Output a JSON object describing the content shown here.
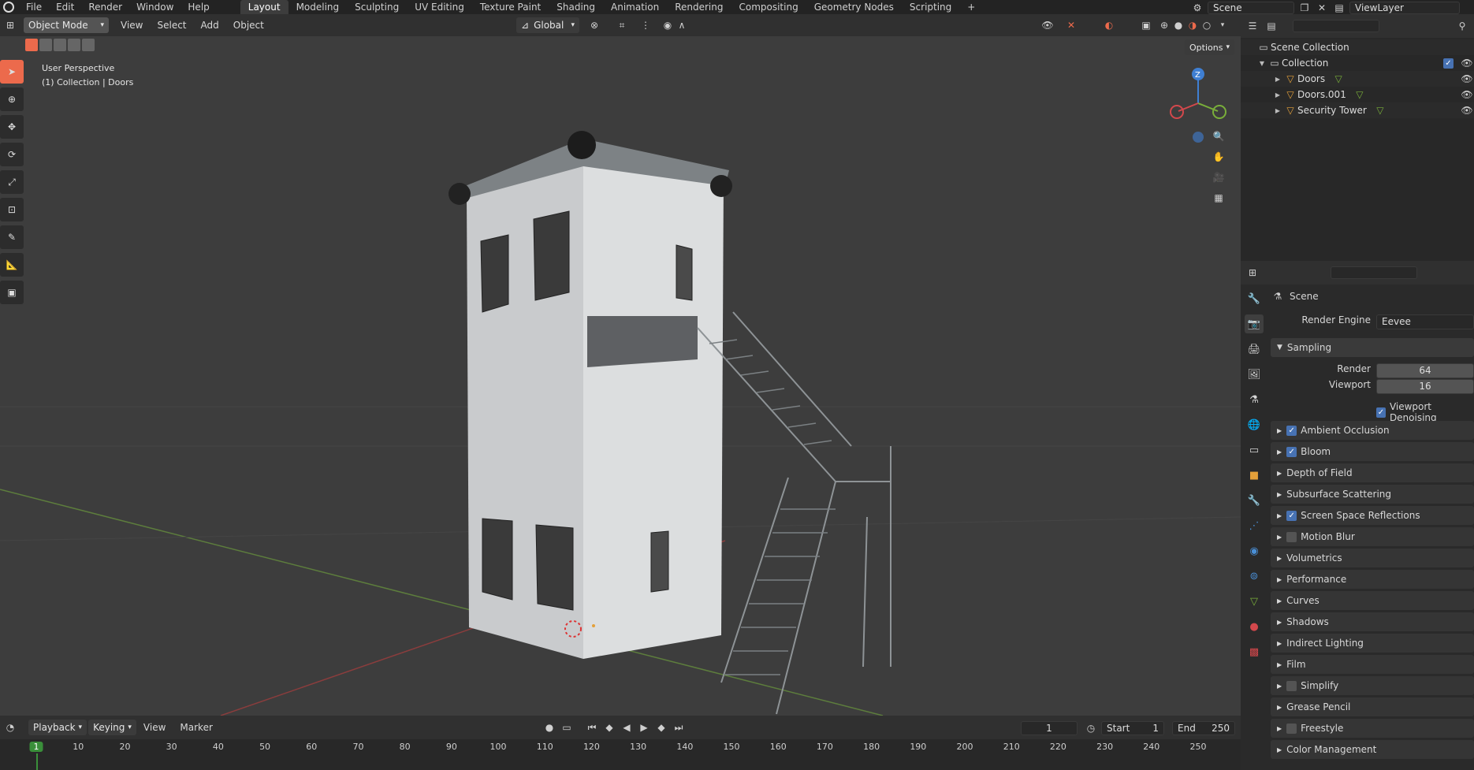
{
  "topbar": {
    "menus": [
      "File",
      "Edit",
      "Render",
      "Window",
      "Help"
    ],
    "workspaces": [
      "Layout",
      "Modeling",
      "Sculpting",
      "UV Editing",
      "Texture Paint",
      "Shading",
      "Animation",
      "Rendering",
      "Compositing",
      "Geometry Nodes",
      "Scripting"
    ],
    "active_workspace": "Layout",
    "add_tab": "+",
    "scene": "Scene",
    "view_layer": "ViewLayer"
  },
  "viewport_header": {
    "mode": "Object Mode",
    "menus": [
      "View",
      "Select",
      "Add",
      "Object"
    ],
    "orientation": "Global",
    "options": "Options"
  },
  "viewport": {
    "perspective": "User Perspective",
    "context": "(1) Collection | Doors",
    "axis_labels": {
      "z": "Z"
    }
  },
  "outliner": {
    "root": "Scene Collection",
    "collection": "Collection",
    "items": [
      "Doors",
      "Doors.001",
      "Security Tower"
    ]
  },
  "properties": {
    "scene_label": "Scene",
    "render_engine_label": "Render Engine",
    "render_engine_value": "Eevee",
    "sampling_label": "Sampling",
    "render_label": "Render",
    "render_value": "64",
    "viewport_label": "Viewport",
    "viewport_value": "16",
    "viewport_denoising": "Viewport Denoising",
    "sections": [
      {
        "label": "Ambient Occlusion",
        "checkbox": true,
        "checked": true
      },
      {
        "label": "Bloom",
        "checkbox": true,
        "checked": true
      },
      {
        "label": "Depth of Field",
        "checkbox": false
      },
      {
        "label": "Subsurface Scattering",
        "checkbox": false
      },
      {
        "label": "Screen Space Reflections",
        "checkbox": true,
        "checked": true
      },
      {
        "label": "Motion Blur",
        "checkbox": true,
        "checked": false
      },
      {
        "label": "Volumetrics",
        "checkbox": false
      },
      {
        "label": "Performance",
        "checkbox": false
      },
      {
        "label": "Curves",
        "checkbox": false
      },
      {
        "label": "Shadows",
        "checkbox": false
      },
      {
        "label": "Indirect Lighting",
        "checkbox": false
      },
      {
        "label": "Film",
        "checkbox": false
      },
      {
        "label": "Simplify",
        "checkbox": true,
        "checked": false
      },
      {
        "label": "Grease Pencil",
        "checkbox": false
      },
      {
        "label": "Freestyle",
        "checkbox": true,
        "checked": false
      },
      {
        "label": "Color Management",
        "checkbox": false
      }
    ]
  },
  "timeline": {
    "menus": [
      "Playback",
      "Keying",
      "View",
      "Marker"
    ],
    "current_frame": "1",
    "start_label": "Start",
    "start_value": "1",
    "end_label": "End",
    "end_value": "250",
    "ruler": [
      "1",
      "10",
      "20",
      "30",
      "40",
      "50",
      "60",
      "70",
      "80",
      "90",
      "100",
      "110",
      "120",
      "130",
      "140",
      "150",
      "160",
      "170",
      "180",
      "190",
      "200",
      "210",
      "220",
      "230",
      "240",
      "250"
    ]
  },
  "colors": {
    "accent": "#4772b3",
    "x_axis": "#d3484c",
    "y_axis": "#79ae3a",
    "z_axis": "#3f7fd3",
    "playhead": "#3a8f3a"
  }
}
